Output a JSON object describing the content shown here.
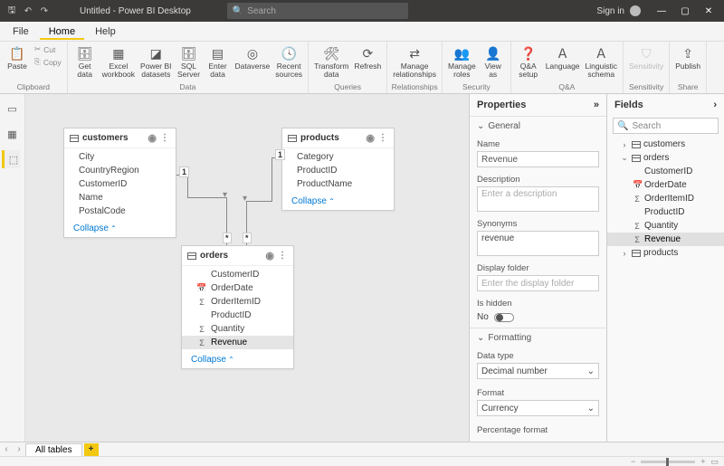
{
  "titlebar": {
    "title": "Untitled - Power BI Desktop",
    "search_placeholder": "Search",
    "signin": "Sign in"
  },
  "menus": {
    "file": "File",
    "home": "Home",
    "help": "Help"
  },
  "ribbon": {
    "clipboard": {
      "title": "Clipboard",
      "paste": "Paste",
      "cut": "Cut",
      "copy": "Copy"
    },
    "data": {
      "title": "Data",
      "get": "Get\ndata",
      "excel": "Excel\nworkbook",
      "pbi": "Power BI\ndatasets",
      "sql": "SQL\nServer",
      "enter": "Enter\ndata",
      "dv": "Dataverse",
      "recent": "Recent\nsources"
    },
    "queries": {
      "title": "Queries",
      "transform": "Transform\ndata",
      "refresh": "Refresh"
    },
    "relationships": {
      "title": "Relationships",
      "manage": "Manage\nrelationships"
    },
    "security": {
      "title": "Security",
      "roles": "Manage\nroles",
      "view": "View\nas"
    },
    "qa": {
      "title": "Q&A",
      "qa": "Q&A\nsetup",
      "lang": "Language",
      "schema": "Linguistic\nschema"
    },
    "sensitivity": {
      "title": "Sensitivity",
      "label": "Sensitivity"
    },
    "share": {
      "title": "Share",
      "publish": "Publish"
    }
  },
  "canvas": {
    "customers": {
      "name": "customers",
      "fields": [
        "City",
        "CountryRegion",
        "CustomerID",
        "Name",
        "PostalCode"
      ],
      "collapse": "Collapse"
    },
    "products": {
      "name": "products",
      "fields": [
        "Category",
        "ProductID",
        "ProductName"
      ],
      "collapse": "Collapse"
    },
    "orders": {
      "name": "orders",
      "fields": [
        {
          "n": "CustomerID",
          "i": ""
        },
        {
          "n": "OrderDate",
          "i": "📅"
        },
        {
          "n": "OrderItemID",
          "i": "Σ"
        },
        {
          "n": "ProductID",
          "i": ""
        },
        {
          "n": "Quantity",
          "i": "Σ"
        },
        {
          "n": "Revenue",
          "i": "Σ",
          "sel": true
        }
      ],
      "collapse": "Collapse"
    },
    "rel": {
      "one": "1",
      "many": "*"
    }
  },
  "props": {
    "title": "Properties",
    "general": "General",
    "name_l": "Name",
    "name_v": "Revenue",
    "desc_l": "Description",
    "desc_ph": "Enter a description",
    "syn_l": "Synonyms",
    "syn_v": "revenue",
    "df_l": "Display folder",
    "df_ph": "Enter the display folder",
    "hidden_l": "Is hidden",
    "hidden_v": "No",
    "formatting": "Formatting",
    "dt_l": "Data type",
    "dt_v": "Decimal number",
    "fmt_l": "Format",
    "fmt_v": "Currency",
    "pct_l": "Percentage format"
  },
  "fields_pane": {
    "title": "Fields",
    "search": "Search",
    "tree": {
      "customers": "customers",
      "orders": "orders",
      "orders_children": [
        "CustomerID",
        "OrderDate",
        "OrderItemID",
        "ProductID",
        "Quantity",
        "Revenue"
      ],
      "orders_icons": [
        "",
        "📅",
        "Σ",
        "",
        "Σ",
        "Σ"
      ],
      "products": "products"
    },
    "selected": "Revenue"
  },
  "footer": {
    "tab": "All tables"
  }
}
